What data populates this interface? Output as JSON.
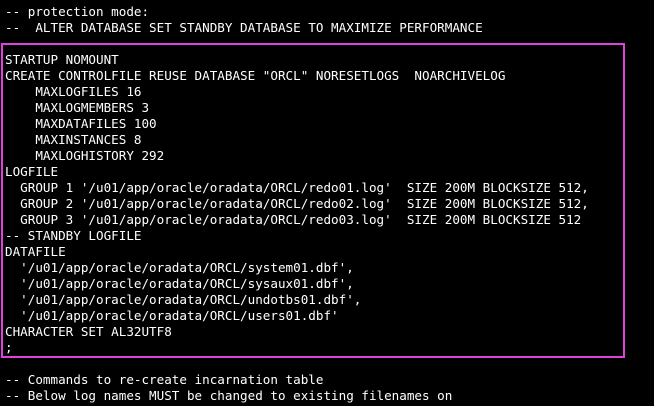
{
  "highlight_color": "#e040e0",
  "text_color": "#ffffff",
  "background_color": "#000000",
  "lines_top": [
    "-- protection mode:",
    "--  ALTER DATABASE SET STANDBY DATABASE TO MAXIMIZE PERFORMANCE"
  ],
  "lines_boxed": [
    "STARTUP NOMOUNT",
    "CREATE CONTROLFILE REUSE DATABASE \"ORCL\" NORESETLOGS  NOARCHIVELOG",
    "    MAXLOGFILES 16",
    "    MAXLOGMEMBERS 3",
    "    MAXDATAFILES 100",
    "    MAXINSTANCES 8",
    "    MAXLOGHISTORY 292",
    "LOGFILE",
    "  GROUP 1 '/u01/app/oracle/oradata/ORCL/redo01.log'  SIZE 200M BLOCKSIZE 512,",
    "  GROUP 2 '/u01/app/oracle/oradata/ORCL/redo02.log'  SIZE 200M BLOCKSIZE 512,",
    "  GROUP 3 '/u01/app/oracle/oradata/ORCL/redo03.log'  SIZE 200M BLOCKSIZE 512",
    "-- STANDBY LOGFILE",
    "DATAFILE",
    "  '/u01/app/oracle/oradata/ORCL/system01.dbf',",
    "  '/u01/app/oracle/oradata/ORCL/sysaux01.dbf',",
    "  '/u01/app/oracle/oradata/ORCL/undotbs01.dbf',",
    "  '/u01/app/oracle/oradata/ORCL/users01.dbf'",
    "CHARACTER SET AL32UTF8",
    ";"
  ],
  "lines_bottom": [
    "-- Commands to re-create incarnation table",
    "-- Below log names MUST be changed to existing filenames on"
  ]
}
